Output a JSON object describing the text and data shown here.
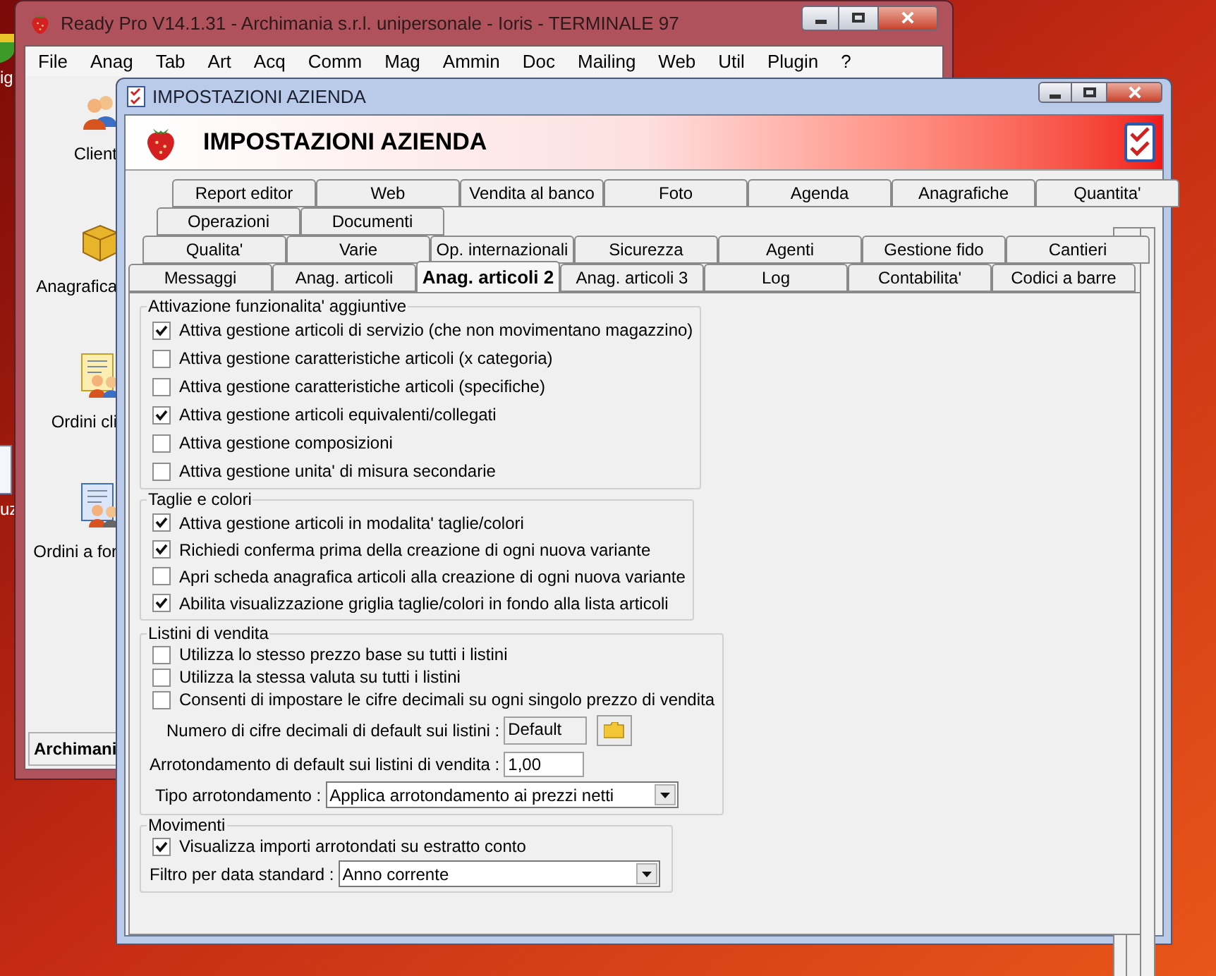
{
  "desktop_icons": [
    {
      "label": "ig"
    },
    {
      "label": "uz"
    }
  ],
  "main_window": {
    "title": "Ready Pro V14.1.31 - Archimania s.r.l. unipersonale - Ioris - TERMINALE 97",
    "menu": [
      "File",
      "Anag",
      "Tab",
      "Art",
      "Acq",
      "Comm",
      "Mag",
      "Ammin",
      "Doc",
      "Mailing",
      "Web",
      "Util",
      "Plugin",
      "?"
    ],
    "sidebar": [
      {
        "kind": "customers",
        "label": "Client"
      },
      {
        "kind": "box",
        "label": "Anagrafica"
      },
      {
        "kind": "orders_customers",
        "label": "Ordini cli"
      },
      {
        "kind": "orders_suppliers",
        "label": "Ordini a for"
      }
    ],
    "status_bar": "Archimani"
  },
  "dialog": {
    "title": "IMPOSTAZIONI AZIENDA",
    "header": "IMPOSTAZIONI AZIENDA",
    "tab_rows": [
      [
        {
          "label": "Report editor",
          "selected": false
        },
        {
          "label": "Web",
          "selected": false
        },
        {
          "label": "Vendita al banco",
          "selected": false
        },
        {
          "label": "Foto",
          "selected": false
        },
        {
          "label": "Agenda",
          "selected": false
        },
        {
          "label": "Anagrafiche",
          "selected": false
        },
        {
          "label": "Quantita'",
          "selected": false
        }
      ],
      [
        {
          "label": "Operazioni",
          "selected": false
        },
        {
          "label": "Documenti",
          "selected": false
        }
      ],
      [
        {
          "label": "Qualita'",
          "selected": false
        },
        {
          "label": "Varie",
          "selected": false
        },
        {
          "label": "Op. internazionali",
          "selected": false
        },
        {
          "label": "Sicurezza",
          "selected": false
        },
        {
          "label": "Agenti",
          "selected": false
        },
        {
          "label": "Gestione fido",
          "selected": false
        },
        {
          "label": "Cantieri",
          "selected": false
        }
      ],
      [
        {
          "label": "Messaggi",
          "selected": false
        },
        {
          "label": "Anag. articoli",
          "selected": false
        },
        {
          "label": "Anag. articoli 2",
          "selected": true
        },
        {
          "label": "Anag. articoli 3",
          "selected": false
        },
        {
          "label": "Log",
          "selected": false
        },
        {
          "label": "Contabilita'",
          "selected": false
        },
        {
          "label": "Codici a barre",
          "selected": false
        }
      ]
    ],
    "groups": [
      {
        "title": "Attivazione funzionalita' aggiuntive",
        "items": [
          {
            "kind": "checkbox",
            "label": "Attiva gestione articoli di servizio (che non movimentano magazzino)",
            "checked": true
          },
          {
            "kind": "checkbox",
            "label": "Attiva gestione caratteristiche articoli (x categoria)",
            "checked": false
          },
          {
            "kind": "checkbox",
            "label": "Attiva gestione caratteristiche articoli (specifiche)",
            "checked": false
          },
          {
            "kind": "checkbox",
            "label": "Attiva gestione articoli equivalenti/collegati",
            "checked": true
          },
          {
            "kind": "checkbox",
            "label": "Attiva gestione composizioni",
            "checked": false
          },
          {
            "kind": "checkbox",
            "label": "Attiva gestione unita' di misura secondarie",
            "checked": false
          }
        ]
      },
      {
        "title": "Taglie e colori",
        "items": [
          {
            "kind": "checkbox",
            "label": "Attiva gestione articoli in modalita' taglie/colori",
            "checked": true
          },
          {
            "kind": "checkbox",
            "label": "Richiedi conferma prima della creazione di ogni nuova variante",
            "checked": true
          },
          {
            "kind": "checkbox",
            "label": "Apri scheda anagrafica articoli alla creazione di ogni nuova variante",
            "checked": false
          },
          {
            "kind": "checkbox",
            "label": "Abilita visualizzazione griglia taglie/colori in fondo alla lista articoli",
            "checked": true
          }
        ]
      },
      {
        "title": "Listini di vendita",
        "items": [
          {
            "kind": "checkbox",
            "label": "Utilizza lo stesso prezzo base su tutti i listini",
            "checked": false
          },
          {
            "kind": "checkbox",
            "label": "Utilizza la stessa valuta su tutti i listini",
            "checked": false
          },
          {
            "kind": "checkbox",
            "label": "Consenti di impostare le cifre decimali su ogni singolo prezzo di vendita",
            "checked": false
          },
          {
            "kind": "folder_field",
            "label": "Numero di cifre decimali di default sui listini :",
            "value": "Default"
          },
          {
            "kind": "text_field",
            "label": "Arrotondamento di default sui listini di vendita :",
            "value": "1,00"
          },
          {
            "kind": "dropdown",
            "label": "Tipo arrotondamento :",
            "value": "Applica arrotondamento ai prezzi netti"
          }
        ]
      },
      {
        "title": "Movimenti",
        "items": [
          {
            "kind": "checkbox",
            "label": "Visualizza importi arrotondati su estratto conto",
            "checked": true
          },
          {
            "kind": "dropdown",
            "label": "Filtro per data standard :",
            "value": "Anno corrente"
          }
        ]
      }
    ]
  }
}
